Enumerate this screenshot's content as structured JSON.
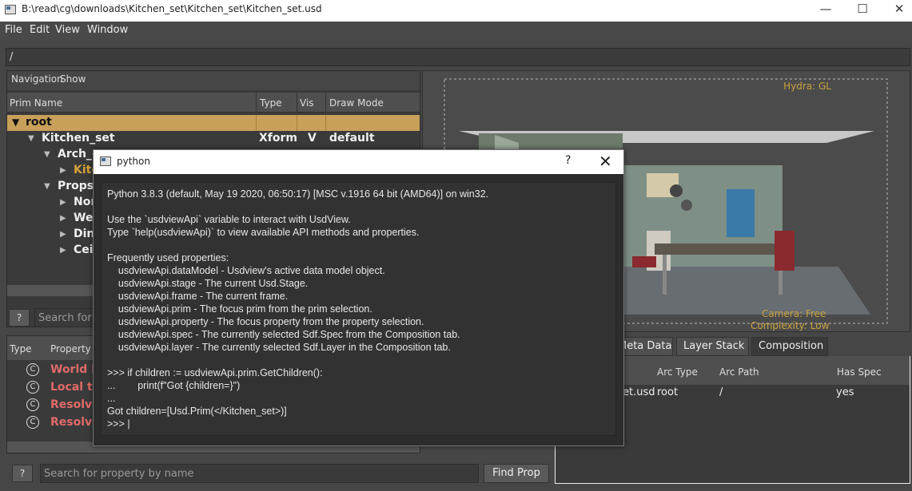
{
  "window": {
    "title": "B:\\read\\cg\\downloads\\Kitchen_set\\Kitchen_set\\Kitchen_set.usd",
    "minimize": "—",
    "maximize": "☐",
    "close": "✕"
  },
  "menu": [
    "File",
    "Edit",
    "View",
    "Window"
  ],
  "path": "/",
  "navigation": {
    "menus": [
      "Navigation",
      "Show"
    ]
  },
  "prim_tree": {
    "columns": [
      "Prim Name",
      "Type",
      "Vis",
      "Draw Mode"
    ],
    "rows": [
      {
        "name": "root",
        "type": "",
        "vis": "",
        "draw_mode": ""
      },
      {
        "name": "Kitchen_set",
        "type": "Xform",
        "vis": "V",
        "draw_mode": "default"
      },
      {
        "name": "Arch_g",
        "type": "",
        "vis": "",
        "draw_mode": ""
      },
      {
        "name": "Kitc",
        "type": "",
        "vis": "",
        "draw_mode": ""
      },
      {
        "name": "Props_",
        "type": "",
        "vis": "",
        "draw_mode": ""
      },
      {
        "name": "Nor",
        "type": "",
        "vis": "",
        "draw_mode": ""
      },
      {
        "name": "We",
        "type": "",
        "vis": "",
        "draw_mode": ""
      },
      {
        "name": "Din",
        "type": "",
        "vis": "",
        "draw_mode": ""
      },
      {
        "name": "Cei",
        "type": "",
        "vis": "",
        "draw_mode": ""
      }
    ]
  },
  "prim_search": {
    "help": "?",
    "placeholder": "Search for p"
  },
  "viewport": {
    "renderer": "Hydra: GL",
    "camera": "Camera: Free",
    "complexity": "Complexity: Low"
  },
  "properties": {
    "columns": [
      "Type",
      "Property Na"
    ],
    "rows": [
      {
        "icon": "C",
        "name": "World B"
      },
      {
        "icon": "C",
        "name": "Local to"
      },
      {
        "icon": "C",
        "name": "Resolve"
      },
      {
        "icon": "C",
        "name": "Resolve"
      }
    ]
  },
  "property_search": {
    "help": "?",
    "placeholder": "Search for property by name",
    "button": "Find Prop"
  },
  "tabs": [
    "Meta Data",
    "Layer Stack",
    "Composition"
  ],
  "composition": {
    "columns": [
      "",
      "Arc Type",
      "Arc Path",
      "Has Spec"
    ],
    "rows": [
      {
        "layer": "et.usd",
        "arc_type": "root",
        "arc_path": "/",
        "has_spec": "yes"
      }
    ]
  },
  "python": {
    "title": "python",
    "help": "?",
    "close": "✕",
    "lines": [
      "Python 3.8.3 (default, May 19 2020, 06:50:17) [MSC v.1916 64 bit (AMD64)] on win32.",
      "",
      "Use the `usdviewApi` variable to interact with UsdView.",
      "Type `help(usdviewApi)` to view available API methods and properties.",
      "",
      "Frequently used properties:",
      "    usdviewApi.dataModel - Usdview's active data model object.",
      "    usdviewApi.stage - The current Usd.Stage.",
      "    usdviewApi.frame - The current frame.",
      "    usdviewApi.prim - The focus prim from the prim selection.",
      "    usdviewApi.property - The focus property from the property selection.",
      "    usdviewApi.spec - The currently selected Sdf.Spec from the Composition tab.",
      "    usdviewApi.layer - The currently selected Sdf.Layer in the Composition tab.",
      "",
      ">>> if children := usdviewApi.prim.GetChildren():",
      "...        print(f\"Got {children=}\")",
      "...",
      "Got children=[Usd.Prim(</Kitchen_set>)]",
      ">>> |"
    ]
  }
}
